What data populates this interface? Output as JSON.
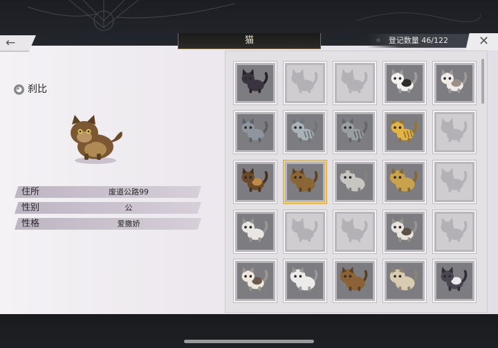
{
  "header": {
    "title": "猫",
    "count_label": "登记数量 46/122",
    "back_symbol": "←",
    "close_symbol": "✕"
  },
  "selected_cat": {
    "name": "刹比",
    "info": [
      {
        "key": "住所",
        "value": "废道公路99"
      },
      {
        "key": "性别",
        "value": "公"
      },
      {
        "key": "性格",
        "value": "爱撒娇"
      }
    ]
  },
  "grid": [
    {
      "state": "filled",
      "color": "#3a3440",
      "belly": "#5a5160",
      "pattern": "solid"
    },
    {
      "state": "empty"
    },
    {
      "state": "empty"
    },
    {
      "state": "filled",
      "color": "#f2f0ee",
      "belly": "#2b2b2b",
      "pattern": "patch"
    },
    {
      "state": "filled",
      "color": "#f0ebe8",
      "belly": "#9b8f88",
      "pattern": "patch"
    },
    {
      "state": "filled",
      "color": "#8e959e",
      "belly": "#b4bac0",
      "pattern": "solid"
    },
    {
      "state": "filled",
      "color": "#a9b3b8",
      "belly": "#e4eaec",
      "pattern": "stripe"
    },
    {
      "state": "filled",
      "color": "#9a9fa3",
      "belly": "#e6e8ea",
      "pattern": "stripe"
    },
    {
      "state": "filled",
      "color": "#e3b445",
      "belly": "#f1e0b4",
      "pattern": "stripe"
    },
    {
      "state": "empty"
    },
    {
      "state": "filled",
      "color": "#6b4a2a",
      "belly": "#c08a4a",
      "pattern": "patch"
    },
    {
      "state": "filled",
      "color": "#8a6637",
      "belly": "#b9935c",
      "pattern": "fluffy",
      "selected": true
    },
    {
      "state": "filled",
      "color": "#c8c6c2",
      "belly": "#8d8b88",
      "pattern": "fluffy"
    },
    {
      "state": "filled",
      "color": "#c9a24e",
      "belly": "#e8d6a6",
      "pattern": "fluffy"
    },
    {
      "state": "empty"
    },
    {
      "state": "filled",
      "color": "#e9e6e4",
      "belly": "#b8c4d4",
      "pattern": "solid"
    },
    {
      "state": "empty"
    },
    {
      "state": "empty"
    },
    {
      "state": "filled",
      "color": "#e9e3dc",
      "belly": "#5c504a",
      "pattern": "patch"
    },
    {
      "state": "empty"
    },
    {
      "state": "filled",
      "color": "#efe8df",
      "belly": "#6c5a4e",
      "pattern": "patch"
    },
    {
      "state": "filled",
      "color": "#ecebea",
      "belly": "#c9c9c9",
      "pattern": "fluffy"
    },
    {
      "state": "filled",
      "color": "#8a6235",
      "belly": "#d0a26a",
      "pattern": "fluffy"
    },
    {
      "state": "filled",
      "color": "#d8cbb1",
      "belly": "#a8957a",
      "pattern": "fluffy"
    },
    {
      "state": "filled",
      "color": "#4a4652",
      "belly": "#ece9ee",
      "pattern": "patch"
    }
  ]
}
